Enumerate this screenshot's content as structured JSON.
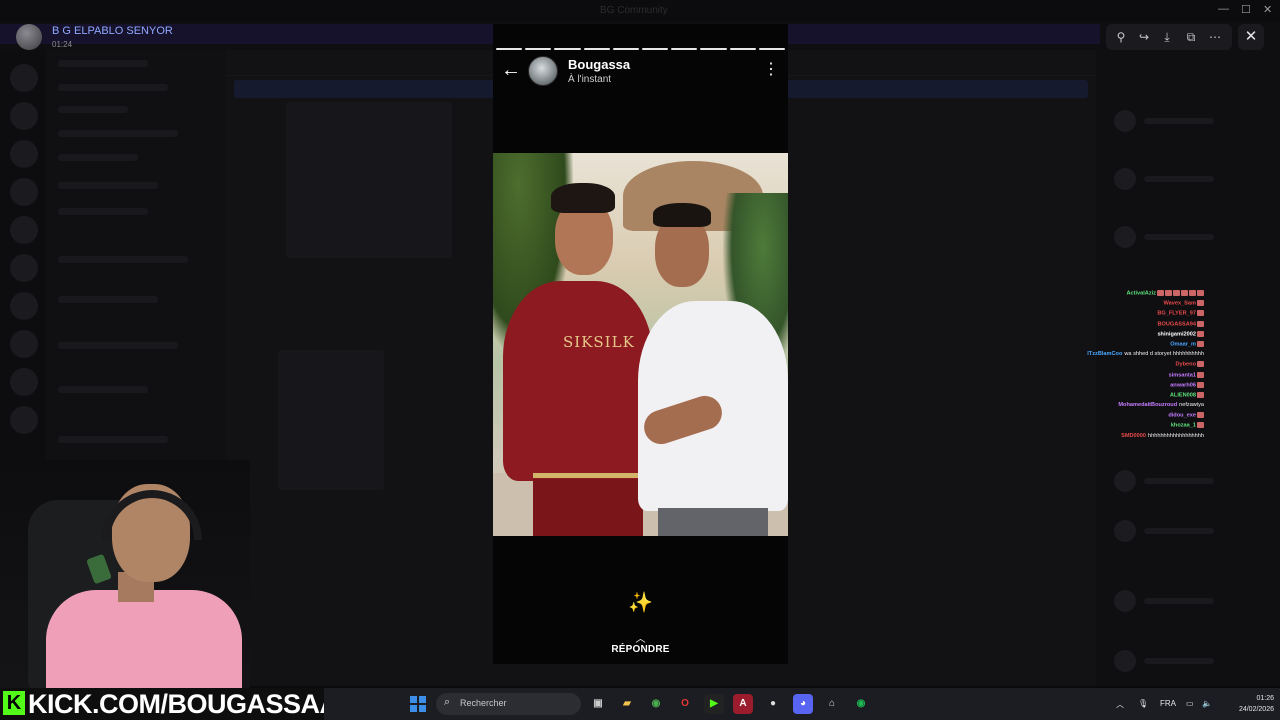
{
  "window": {
    "title": "BG Community"
  },
  "poster": {
    "name": "B G ELPABLO SENYOR",
    "time": "01:24"
  },
  "story": {
    "name": "Bougassa",
    "time": "À l'instant",
    "photo_text": "SIKSILK",
    "reply_label": "RÉPONDRE"
  },
  "viewer_tools": [
    "zoom-in-icon",
    "forward-icon",
    "download-icon",
    "open-external-icon",
    "more-icon"
  ],
  "stream": {
    "overlay_text": "KICK.COM/BOUGASSAA"
  },
  "chat_overlay": [
    {
      "user": "ActivalAziz",
      "msg": "",
      "color": "#5ee27a",
      "emotes": 6
    },
    {
      "user": "Wavex_Sam",
      "msg": "",
      "color": "#e84a4a",
      "emotes": 1
    },
    {
      "user": "BG_FLYER_97",
      "msg": "",
      "color": "#e84a4a",
      "emotes": 1
    },
    {
      "user": "BOUGASSA94",
      "msg": "",
      "color": "#e84a4a",
      "emotes": 1
    },
    {
      "user": "shinigami2002",
      "msg": "",
      "color": "#ffffff",
      "emotes": 1
    },
    {
      "user": "Omaar_m",
      "msg": "",
      "color": "#4aa8ff",
      "emotes": 1
    },
    {
      "user": "ITzzBlamCoo",
      "msg": "wa shhed d storyet hhhhhhhhhh",
      "color": "#4aa8ff",
      "emotes": 0
    },
    {
      "user": "Dybeno",
      "msg": "",
      "color": "#e84a4a",
      "emotes": 1
    },
    {
      "user": "simsanta1",
      "msg": "",
      "color": "#c77dff",
      "emotes": 1
    },
    {
      "user": "anwarh06",
      "msg": "",
      "color": "#c77dff",
      "emotes": 1
    },
    {
      "user": "ALIEN008",
      "msg": "",
      "color": "#5ee27a",
      "emotes": 1
    },
    {
      "user": "MohamedaitBouzroud",
      "msg": "nefzawiya",
      "color": "#c77dff",
      "emotes": 0
    },
    {
      "user": "didou_exe",
      "msg": "",
      "color": "#c77dff",
      "emotes": 1
    },
    {
      "user": "khozaa_1",
      "msg": "",
      "color": "#5ee27a",
      "emotes": 1
    },
    {
      "user": "SMD0000",
      "msg": "hhhhhhhhhhhhhhhhhh",
      "color": "#e84a4a",
      "emotes": 0
    }
  ],
  "taskbar": {
    "search_placeholder": "Rechercher",
    "lang": "FRA",
    "time": "01:26",
    "date": "24/02/2026"
  }
}
